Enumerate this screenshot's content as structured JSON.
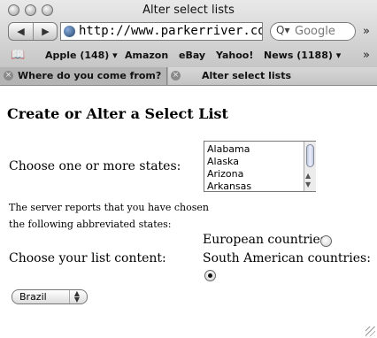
{
  "window": {
    "title": "Alter select lists"
  },
  "toolbar": {
    "back_icon": "back-arrow-icon",
    "forward_icon": "forward-arrow-icon",
    "url": "http://www.parkerriver.com/ajaxh",
    "search_placeholder": "Google",
    "overflow": "»"
  },
  "bookmarks": {
    "book_glyph": "📖",
    "items": [
      {
        "label": "Apple (148) ▾"
      },
      {
        "label": "Amazon"
      },
      {
        "label": "eBay"
      },
      {
        "label": "Yahoo!"
      },
      {
        "label": "News (1188) ▾"
      }
    ],
    "overflow": "»"
  },
  "tabs": [
    {
      "label": "Where do you come from?",
      "active": false
    },
    {
      "label": "Alter select lists",
      "active": true
    }
  ],
  "page": {
    "heading": "Create or Alter a Select List",
    "states_label": "Choose one or more states:",
    "states_options": [
      "Alabama",
      "Alaska",
      "Arizona",
      "Arkansas"
    ],
    "server_text_line1": "The server reports that you have chosen",
    "server_text_line2": "the following abbreviated states:",
    "content_label": "Choose your list content:",
    "european_label": "European countries:",
    "south_american_label": "South American countries:",
    "selected_content": "south_american",
    "country_select_value": "Brazil"
  }
}
